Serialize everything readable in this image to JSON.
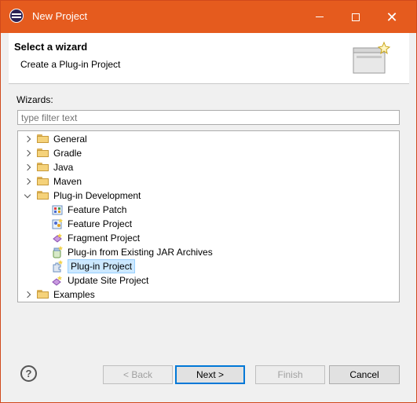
{
  "window": {
    "title": "New Project"
  },
  "header": {
    "title": "Select a wizard",
    "description": "Create a Plug-in Project"
  },
  "wizards": {
    "label": "Wizards:",
    "filter_placeholder": "type filter text"
  },
  "tree": [
    {
      "label": "General",
      "type": "folder",
      "expanded": false
    },
    {
      "label": "Gradle",
      "type": "folder",
      "expanded": false
    },
    {
      "label": "Java",
      "type": "folder",
      "expanded": false
    },
    {
      "label": "Maven",
      "type": "folder",
      "expanded": false
    },
    {
      "label": "Plug-in Development",
      "type": "folder",
      "expanded": true
    },
    {
      "label": "Feature Patch",
      "type": "item",
      "icon": "feature-patch-icon"
    },
    {
      "label": "Feature Project",
      "type": "item",
      "icon": "feature-project-icon"
    },
    {
      "label": "Fragment Project",
      "type": "item",
      "icon": "fragment-project-icon"
    },
    {
      "label": "Plug-in from Existing JAR Archives",
      "type": "item",
      "icon": "jar-plugin-icon"
    },
    {
      "label": "Plug-in Project",
      "type": "item",
      "icon": "plugin-project-icon",
      "selected": true
    },
    {
      "label": "Update Site Project",
      "type": "item",
      "icon": "update-site-icon"
    },
    {
      "label": "Examples",
      "type": "folder",
      "expanded": false
    }
  ],
  "buttons": {
    "help": "?",
    "back": "< Back",
    "next": "Next >",
    "finish": "Finish",
    "cancel": "Cancel"
  },
  "colors": {
    "titlebar": "#e55b1e",
    "selection": "#cce8ff",
    "default_button_border": "#0078d7"
  }
}
